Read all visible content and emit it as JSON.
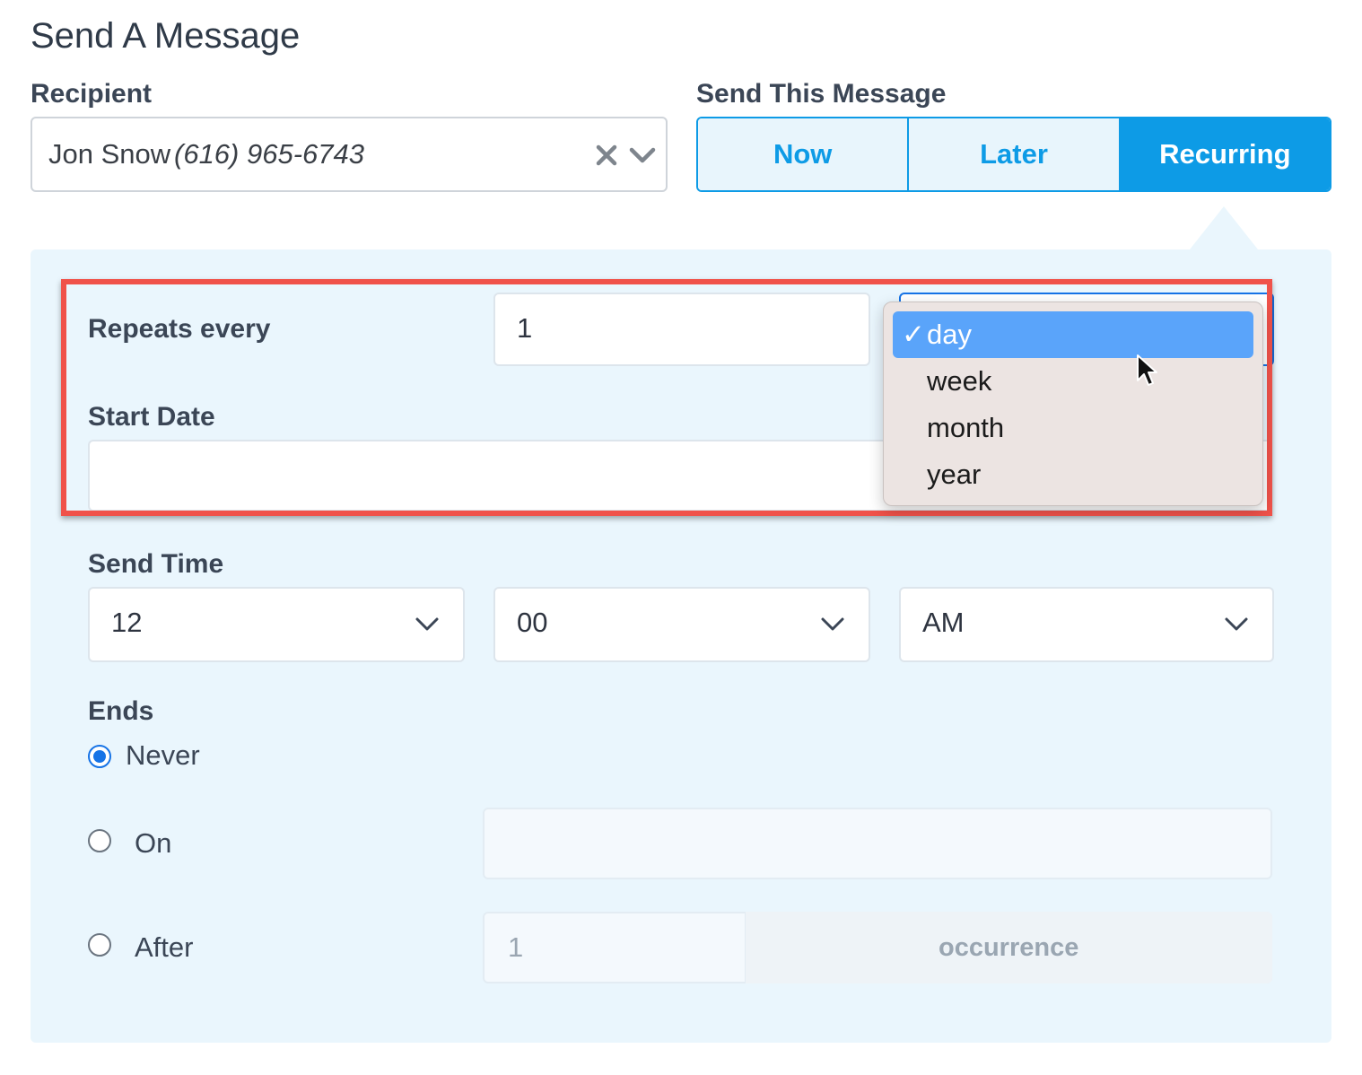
{
  "title": "Send A Message",
  "recipient": {
    "label": "Recipient",
    "name": "Jon Snow",
    "phone": "(616) 965-6743"
  },
  "send_mode": {
    "label": "Send This Message",
    "options": [
      "Now",
      "Later",
      "Recurring"
    ],
    "selected": "Recurring"
  },
  "repeats": {
    "label": "Repeats every",
    "value": "1",
    "unit_options": [
      "day",
      "week",
      "month",
      "year"
    ],
    "selected_unit": "day",
    "check_mark": "✓"
  },
  "start_date": {
    "label": "Start Date",
    "value": ""
  },
  "send_time": {
    "label": "Send Time",
    "hour": "12",
    "minute": "00",
    "period": "AM"
  },
  "ends": {
    "label": "Ends",
    "never_label": "Never",
    "on_label": "On",
    "after_label": "After",
    "selected": "Never",
    "after_count": "1",
    "occurrence_label": "occurrence"
  },
  "colors": {
    "accent": "#0d9be6",
    "highlight": "#f0524a",
    "panel": "#eaf6fd",
    "menu_selected": "#5aa4fa"
  }
}
